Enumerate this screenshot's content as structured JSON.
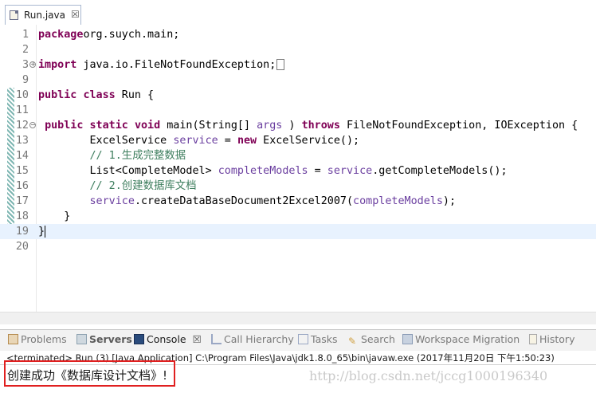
{
  "editor_tab": {
    "label": "Run.java",
    "close": "☒"
  },
  "lines": [
    {
      "n": "1",
      "parts": [
        [
          "kw",
          "package"
        ],
        [
          "",
          "org.suych.main;"
        ]
      ]
    },
    {
      "n": "2",
      "parts": []
    },
    {
      "n": "3",
      "fold": "+",
      "parts": [
        [
          "kw",
          "import"
        ],
        [
          "",
          " java.io.FileNotFoundException;"
        ]
      ],
      "box": true
    },
    {
      "n": "9",
      "parts": []
    },
    {
      "n": "10",
      "parts": [
        [
          "kw",
          "public"
        ],
        [
          "",
          " "
        ],
        [
          "kw",
          "class"
        ],
        [
          "",
          " Run {"
        ]
      ]
    },
    {
      "n": "11",
      "parts": []
    },
    {
      "n": "12",
      "fold": "−",
      "parts": [
        [
          "",
          " "
        ],
        [
          "kw",
          "public"
        ],
        [
          "",
          " "
        ],
        [
          "kw",
          "static"
        ],
        [
          "",
          " "
        ],
        [
          "kw",
          "void"
        ],
        [
          "",
          " main(String[] "
        ],
        [
          "prm",
          "args"
        ],
        [
          "",
          " ) "
        ],
        [
          "kw",
          "throws"
        ],
        [
          "",
          " FileNotFoundException, IOException {"
        ]
      ]
    },
    {
      "n": "13",
      "parts": [
        [
          "",
          "        ExcelService "
        ],
        [
          "fld",
          "service"
        ],
        [
          "",
          " = "
        ],
        [
          "kw",
          "new"
        ],
        [
          "",
          " ExcelService();"
        ]
      ]
    },
    {
      "n": "14",
      "parts": [
        [
          "cm",
          "        // 1.生成完整数据"
        ]
      ]
    },
    {
      "n": "15",
      "parts": [
        [
          "",
          "        List<CompleteModel> "
        ],
        [
          "fld",
          "completeModels"
        ],
        [
          "",
          " = "
        ],
        [
          "fld",
          "service"
        ],
        [
          "",
          ".getCompleteModels();"
        ]
      ]
    },
    {
      "n": "16",
      "parts": [
        [
          "cm",
          "        // 2.创建数据库文档"
        ]
      ]
    },
    {
      "n": "17",
      "parts": [
        [
          "fld",
          "        service"
        ],
        [
          "",
          ".createDataBaseDocument2Excel2007("
        ],
        [
          "fld",
          "completeModels"
        ],
        [
          "",
          ");"
        ]
      ]
    },
    {
      "n": "18",
      "parts": [
        [
          "",
          "    }"
        ]
      ]
    },
    {
      "n": "19",
      "parts": [
        [
          "",
          "}"
        ]
      ],
      "current": true,
      "cursor": true
    },
    {
      "n": "20",
      "parts": []
    }
  ],
  "views": {
    "problems": "Problems",
    "servers": "Servers",
    "console": "Console",
    "console_close": "☒",
    "call_hierarchy": "Call Hierarchy",
    "tasks": "Tasks",
    "search": "Search",
    "workspace_migration": "Workspace Migration",
    "history": "History"
  },
  "console": {
    "status": "<terminated> Run (3) [Java Application] C:\\Program Files\\Java\\jdk1.8.0_65\\bin\\javaw.exe (2017年11月20日 下午1:50:23)",
    "output": "创建成功《数据库设计文档》!",
    "watermark": "http://blog.csdn.net/jccg1000196340"
  },
  "colors": {
    "keyword": "#7f0055",
    "comment": "#3f7f5f",
    "field": "#6a3e9f",
    "highlight": "#e8f2fe",
    "output_box": "#e02020"
  }
}
